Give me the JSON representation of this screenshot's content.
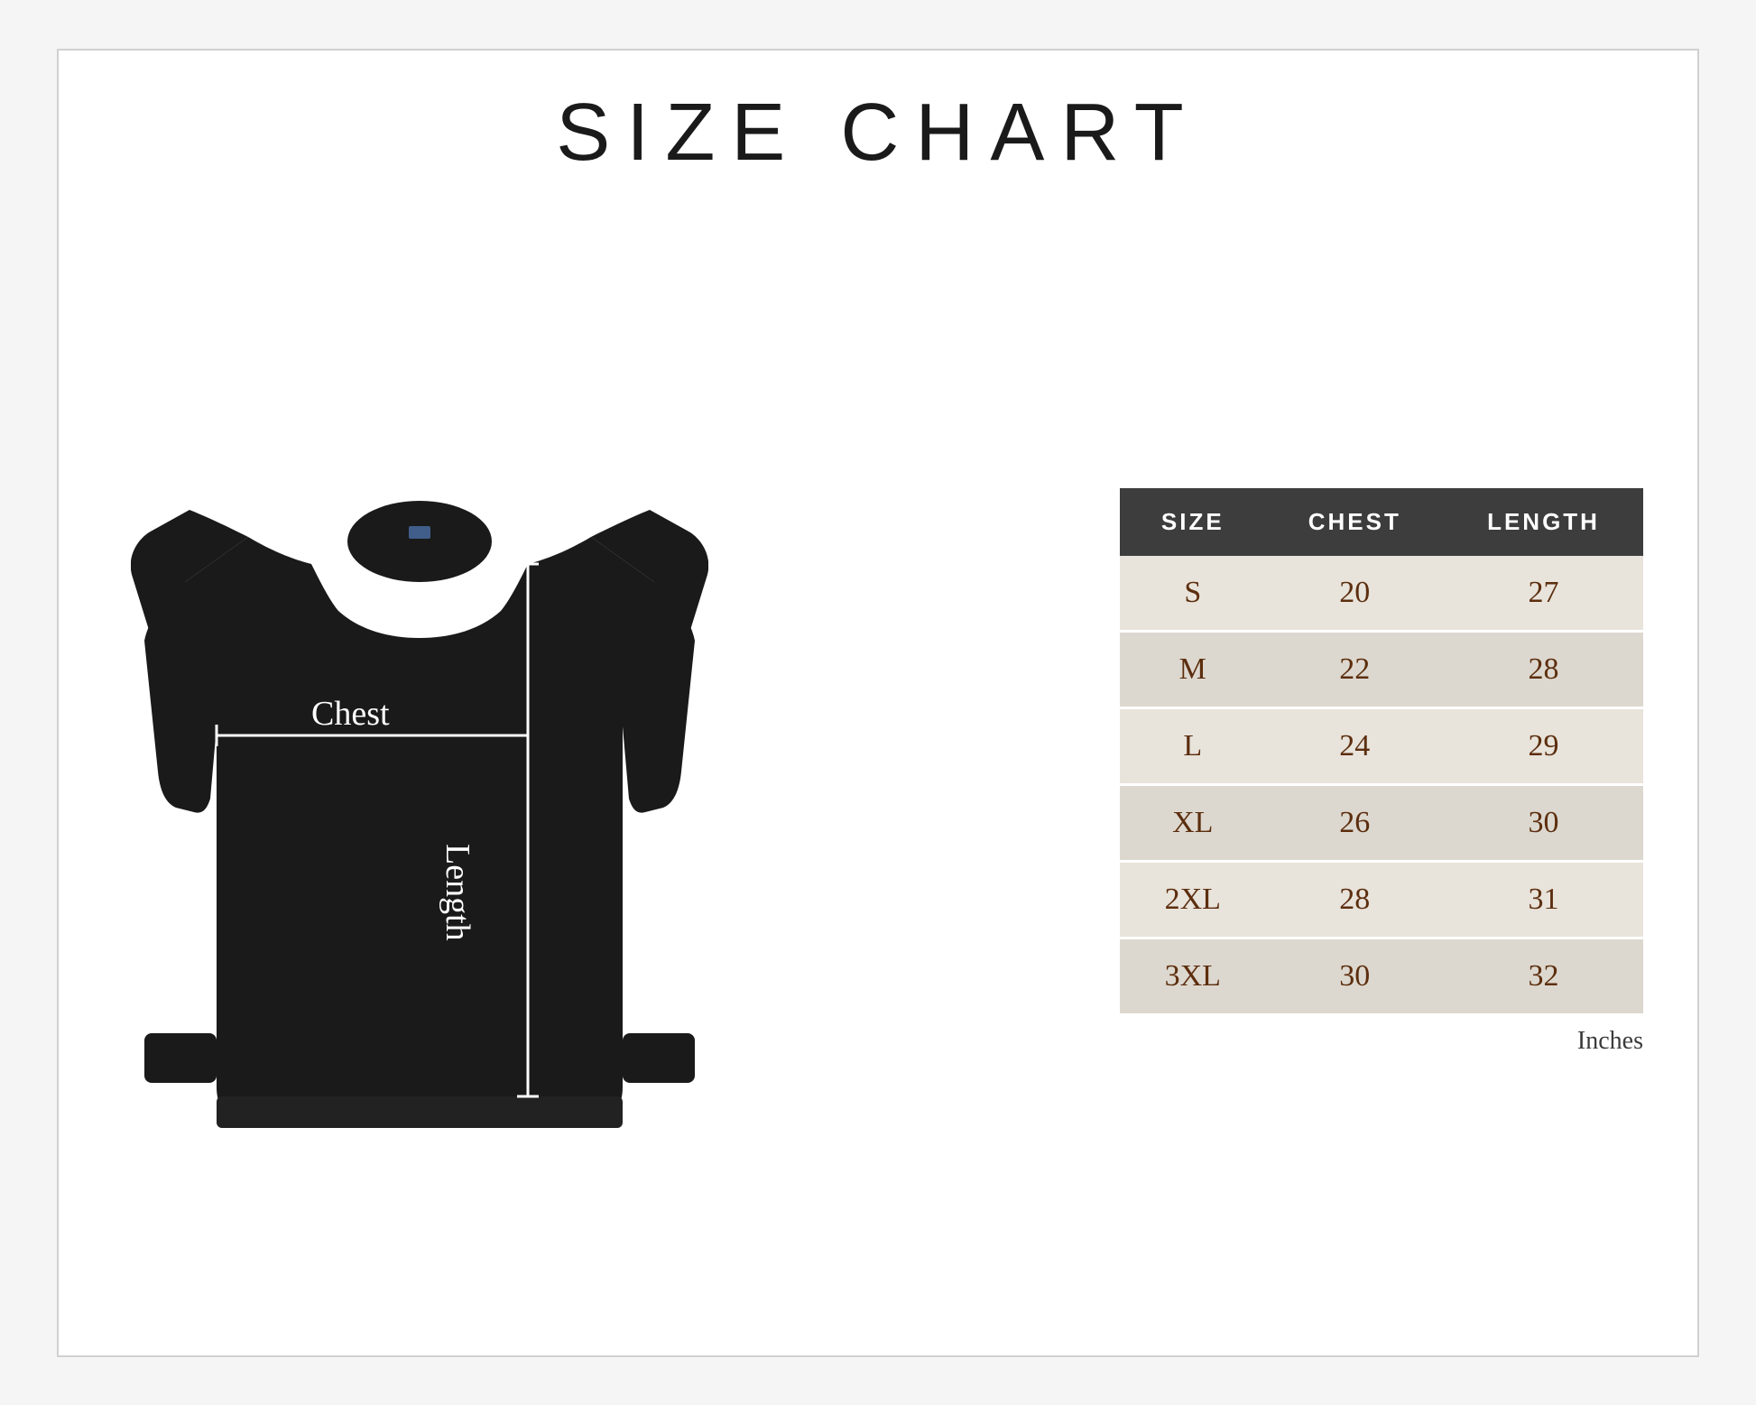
{
  "page": {
    "title": "SIZE CHART",
    "background": "#ffffff"
  },
  "table": {
    "headers": [
      "SIZE",
      "CHEST",
      "LENGTH"
    ],
    "rows": [
      {
        "size": "S",
        "chest": "20",
        "length": "27"
      },
      {
        "size": "M",
        "chest": "22",
        "length": "28"
      },
      {
        "size": "L",
        "chest": "24",
        "length": "29"
      },
      {
        "size": "XL",
        "chest": "26",
        "length": "30"
      },
      {
        "size": "2XL",
        "chest": "28",
        "length": "31"
      },
      {
        "size": "3XL",
        "chest": "30",
        "length": "32"
      }
    ],
    "unit": "Inches"
  },
  "diagram": {
    "chest_label": "Chest",
    "length_label": "Length"
  },
  "colors": {
    "header_bg": "#3d3d3d",
    "header_text": "#ffffff",
    "row_bg": "#e8e3db",
    "row_text": "#5c2e0e",
    "sweatshirt": "#1a1a1a",
    "line_color": "#ffffff"
  }
}
